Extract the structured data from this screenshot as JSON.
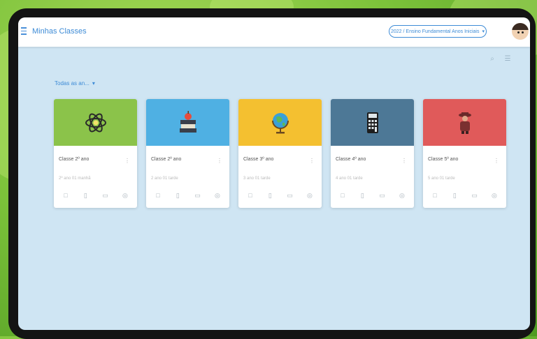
{
  "app": {
    "title": "Minhas Classes"
  },
  "header": {
    "class_select": "2022 / Ensino Fundamental Anos Iniciais",
    "select_chevron": "▾"
  },
  "toolbar": {
    "search_icon": "⌕",
    "list_icon": "☰"
  },
  "sort": {
    "label": "Todas as an...",
    "chevron": "▾"
  },
  "cards": [
    {
      "name": "Classe 2º ano",
      "meta": "2º ano 01 manhã",
      "color": "#8bc34a",
      "icon": "atom-icon"
    },
    {
      "name": "Classe 2º ano",
      "meta": "2 ano 01 tarde",
      "color": "#4fb0e3",
      "icon": "books-apple-icon"
    },
    {
      "name": "Classe 3º ano",
      "meta": "3 ano 01 tarde",
      "color": "#f4c030",
      "icon": "globe-icon"
    },
    {
      "name": "Classe 4º ano",
      "meta": "4 ano 01 tarde",
      "color": "#4d7896",
      "icon": "calculator-icon"
    },
    {
      "name": "Classe 5º ano",
      "meta": "5 ano 01 tarde",
      "color": "#e05a5a",
      "icon": "explorer-icon"
    }
  ],
  "card_actions": [
    "□",
    "▯",
    "▭",
    "◎"
  ],
  "kebab": "⋮"
}
